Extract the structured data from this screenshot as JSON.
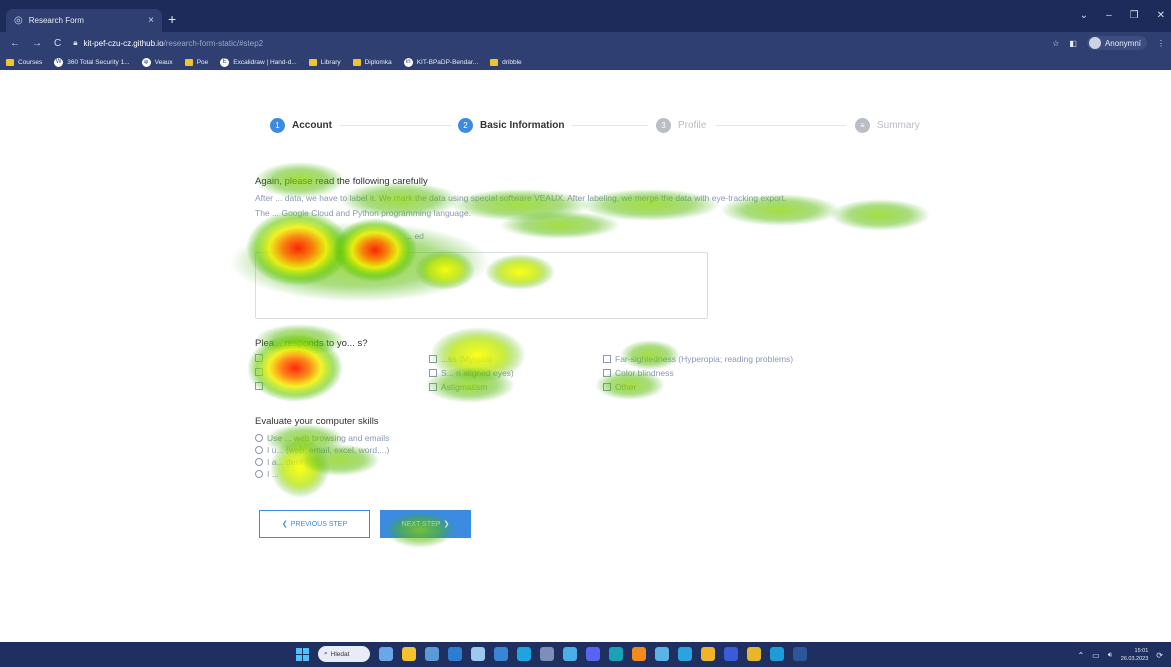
{
  "browser": {
    "tab_title": "Research Form",
    "url_host": "kit-pef-czu-cz.github.io",
    "url_path": "/research-form-static/#step2",
    "profile_label": "Anonymní",
    "bookmarks": [
      {
        "label": "Courses",
        "icon": "folder-icon"
      },
      {
        "label": "360 Total Security 1...",
        "icon": "wordpress-icon"
      },
      {
        "label": "Veaux",
        "icon": "veaux-icon"
      },
      {
        "label": "Poe",
        "icon": "folder-icon"
      },
      {
        "label": "Excalidraw | Hand-d...",
        "icon": "excalidraw-icon"
      },
      {
        "label": "Library",
        "icon": "folder-icon"
      },
      {
        "label": "Diplomka",
        "icon": "folder-icon"
      },
      {
        "label": "KIT-BPaDP-Bendar...",
        "icon": "linkedin-icon"
      },
      {
        "label": "dribble",
        "icon": "folder-icon"
      }
    ]
  },
  "stepper": {
    "steps": [
      {
        "num": "1",
        "label": "Account",
        "state": "active"
      },
      {
        "num": "2",
        "label": "Basic Information",
        "state": "active"
      },
      {
        "num": "3",
        "label": "Profile",
        "state": "inactive"
      },
      {
        "num": "",
        "label": "Summary",
        "state": "inactive"
      }
    ]
  },
  "form": {
    "notice_title": "Again, please read the following carefully",
    "notice_line1": "After ... data, we have to label it. We mark the data using special software VEAUX. After labeling, we merge the data with eye-tracking export.",
    "notice_line2": "The ... Google Cloud and Python programming language.",
    "textarea_label": "... ed",
    "eye_question": "Plea... responds to yo... s?",
    "checkboxes": [
      {
        "label": ""
      },
      {
        "label": ""
      },
      {
        "label": ""
      },
      {
        "label": "...ss (Myopia)"
      },
      {
        "label": "S... n aligned eyes)"
      },
      {
        "label": "Astigmatism"
      },
      {
        "label": "Far-sightedness (Hyperopia; reading problems)"
      },
      {
        "label": "Color blindness"
      },
      {
        "label": "Other"
      }
    ],
    "skills_title": "Evaluate your computer skills",
    "radios": [
      {
        "label": "Use ... web browsing and emails"
      },
      {
        "label": "I u... (web, email, excel, word,...)"
      },
      {
        "label": "I a... dent"
      },
      {
        "label": "I ..."
      }
    ],
    "prev_label": "PREVIOUS STEP",
    "next_label": "NEXT STEP"
  },
  "taskbar": {
    "search_label": "Hledat",
    "time": "15:01",
    "date": "26.03.2023"
  },
  "colors": {
    "accent": "#3d8be0",
    "titlebar": "#1c2b5a",
    "toolbar": "#2f3f72",
    "muted_text": "#8b97b6",
    "inactive_step": "#b9bdc4"
  }
}
